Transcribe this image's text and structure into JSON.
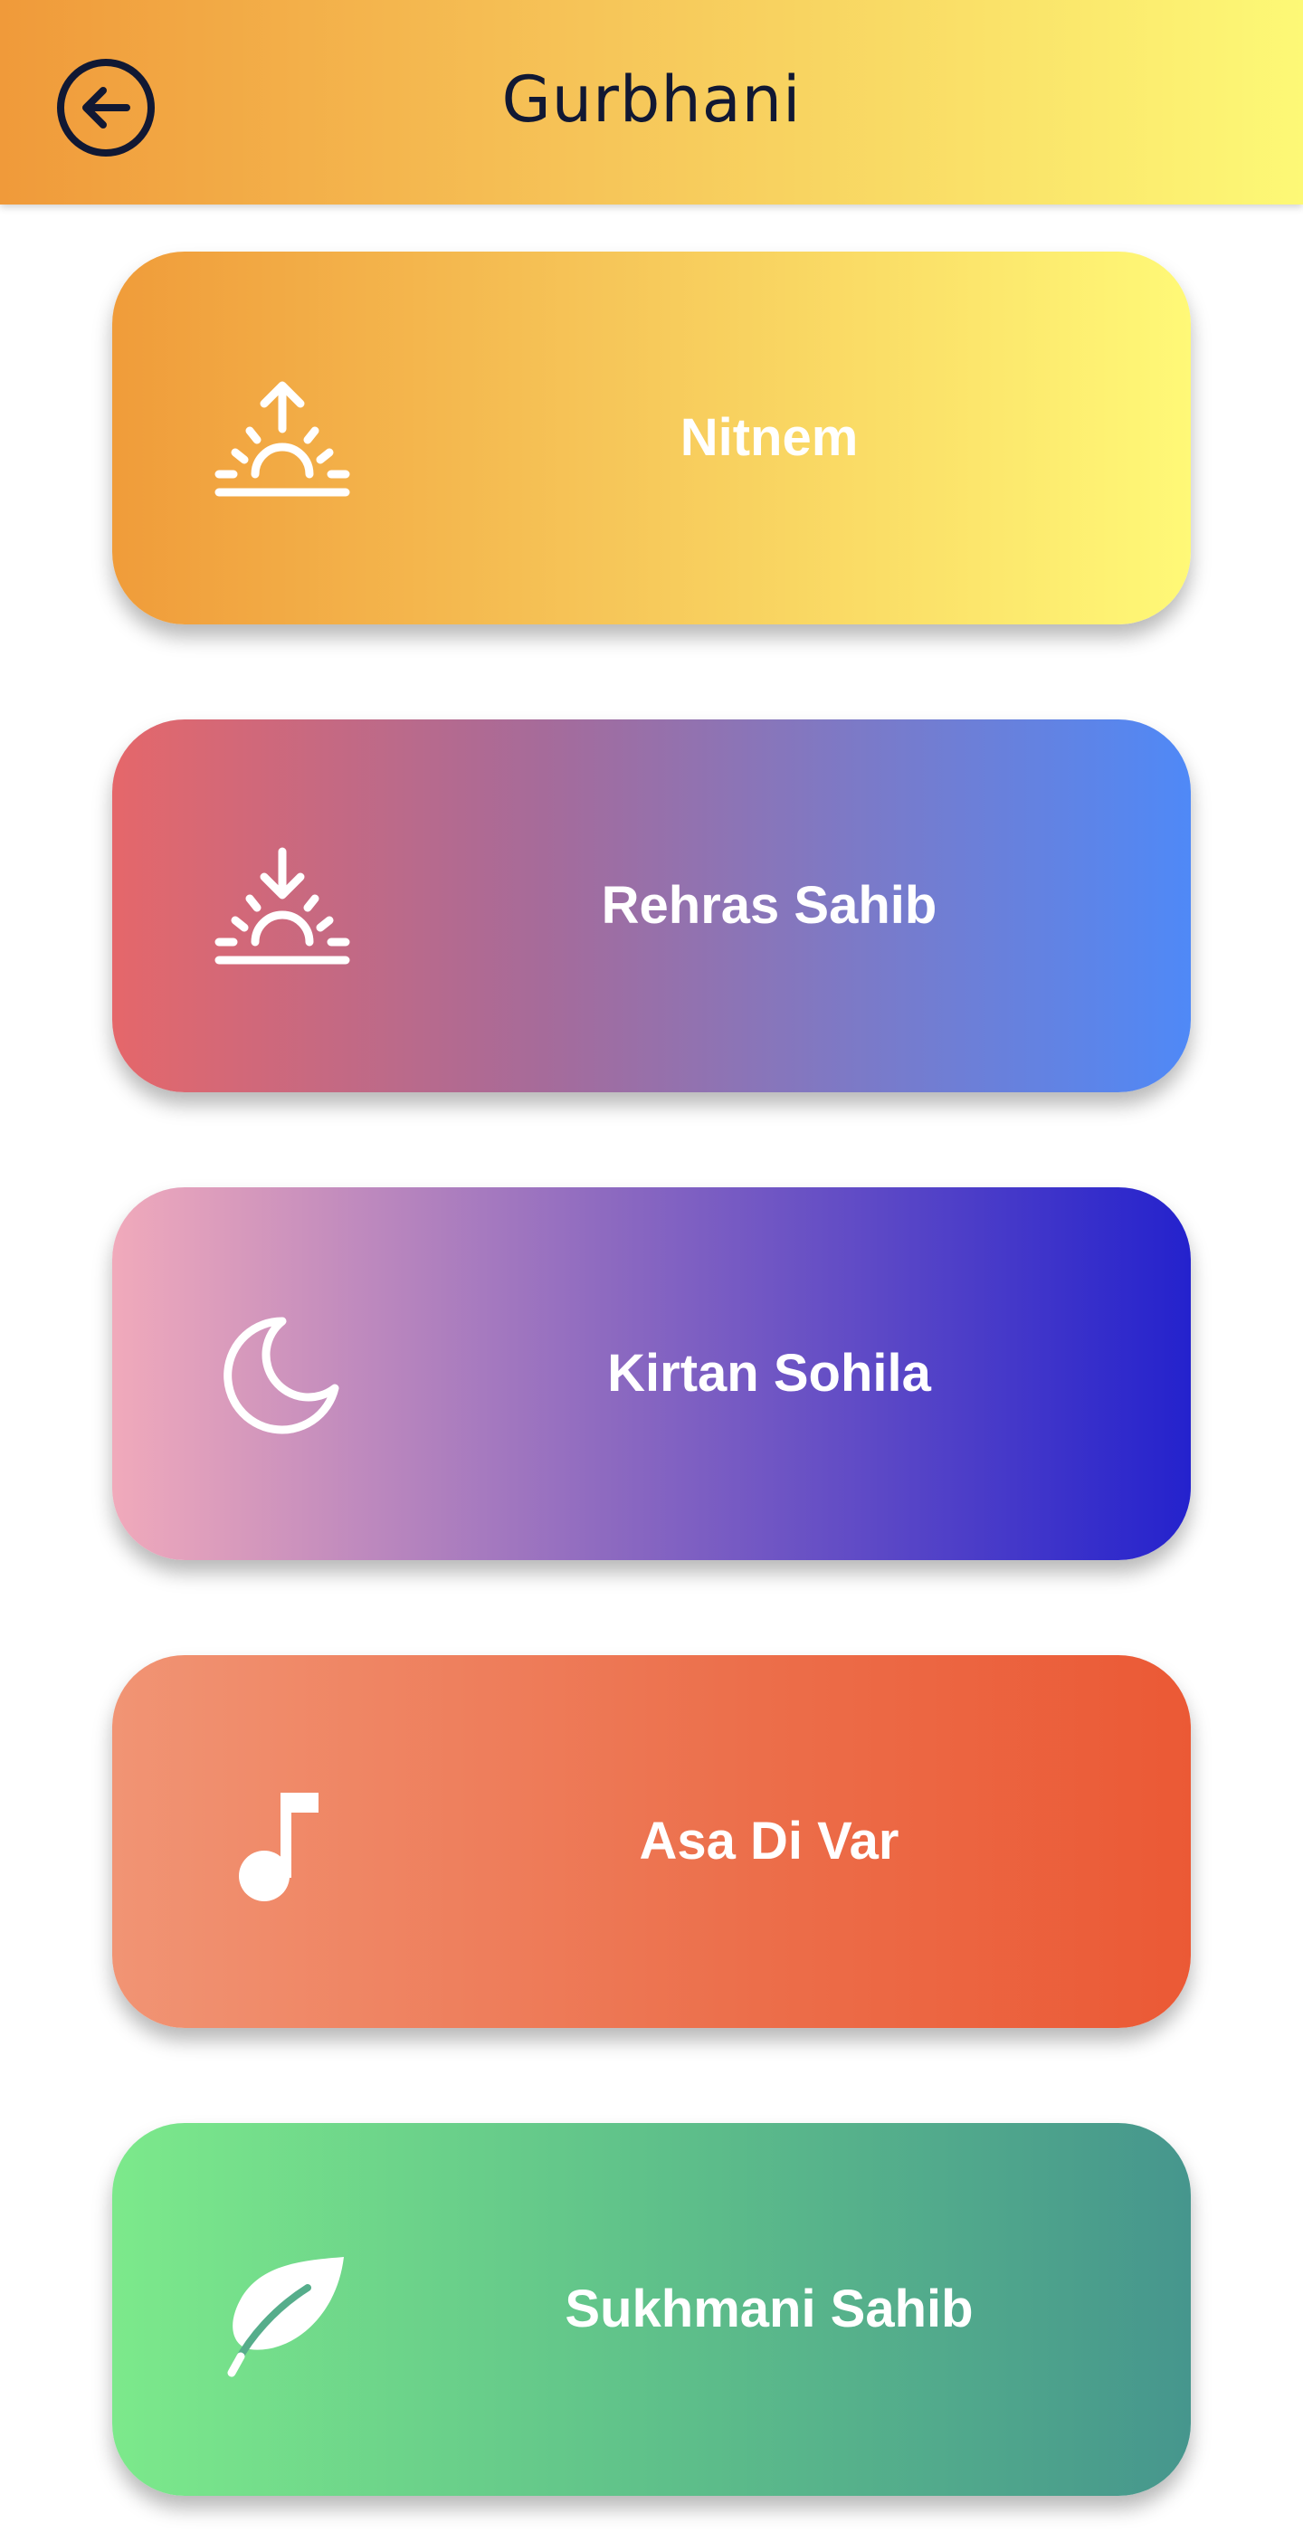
{
  "header": {
    "title": "Gurbhani",
    "back_icon": "arrow-left-circle-icon",
    "gradient": [
      "#f09a3a",
      "#fdf976"
    ],
    "text_color": "#111833"
  },
  "cards": [
    {
      "label": "Nitnem",
      "icon": "sunrise-icon",
      "gradient": [
        "#f09c3a",
        "#fff977"
      ]
    },
    {
      "label": "Rehras Sahib",
      "icon": "sunset-icon",
      "gradient": [
        "#e5676a",
        "#4f89f7"
      ]
    },
    {
      "label": "Kirtan Sohila",
      "icon": "moon-icon",
      "gradient": [
        "#f1aabb",
        "#2422cd"
      ]
    },
    {
      "label": "Asa Di Var",
      "icon": "music-note-icon",
      "gradient": [
        "#f19474",
        "#eb5935"
      ]
    },
    {
      "label": "Sukhmani Sahib",
      "icon": "leaf-icon",
      "gradient": [
        "#7ce98b",
        "#46968d"
      ]
    }
  ]
}
